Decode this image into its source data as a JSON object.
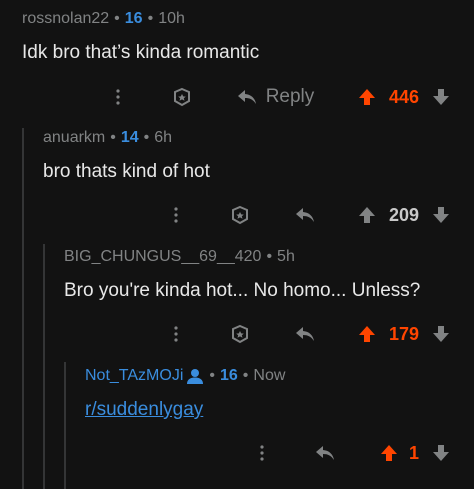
{
  "comments": [
    {
      "author": "rossnolan22",
      "score": "16",
      "age": "10h",
      "body": "Idk bro that’s kinda romantic",
      "votes": "446",
      "upvoted": true,
      "reply_label": "Reply"
    },
    {
      "author": "anuarkm",
      "score": "14",
      "age": "6h",
      "body": "bro thats kind of hot",
      "votes": "209",
      "upvoted": false
    },
    {
      "author": "BIG_CHUNGUS__69__420",
      "score": "",
      "age": "5h",
      "body": "Bro you're kinda hot... No homo... Unless?",
      "votes": "179",
      "upvoted": true
    },
    {
      "author": "Not_TAzMOJi",
      "score": "16",
      "age": "Now",
      "body": "r/suddenlygay",
      "votes": "1",
      "upvoted": true
    }
  ],
  "colors": {
    "background": "#121212",
    "upvote": "#ff4500",
    "accent": "#3a8dde",
    "muted": "#818384"
  },
  "icons": [
    "more-vertical-icon",
    "award-icon",
    "reply-arrow-icon",
    "upvote-arrow-icon",
    "downvote-arrow-icon",
    "person-icon"
  ]
}
